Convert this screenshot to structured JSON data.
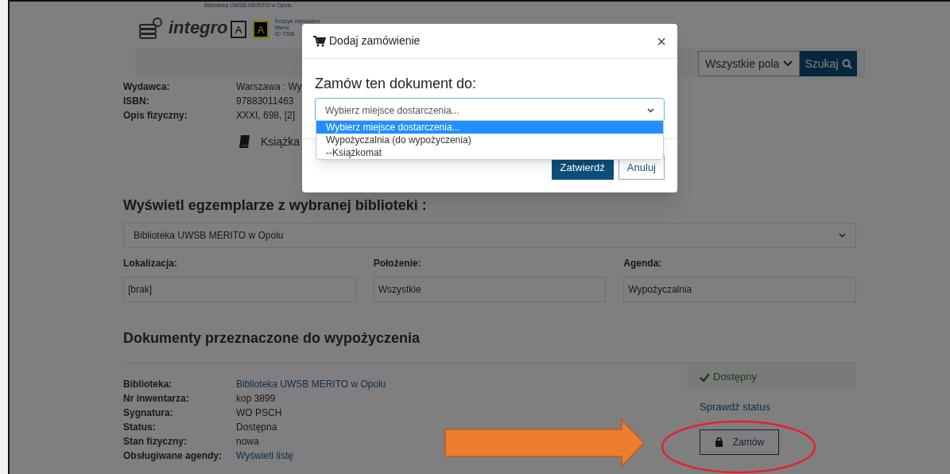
{
  "header": {
    "library_name": "Biblioteka UWSB MERITO w Opolu",
    "logo_text": "integro",
    "contrast_buttons": [
      {
        "label": "A",
        "kind": "normal"
      },
      {
        "label": "A",
        "kind": "high"
      }
    ],
    "links": [
      "Koszyk zamówień",
      "Menu",
      "ID 7266"
    ]
  },
  "search": {
    "field_select": "Wszystkie pola",
    "button": "Szukaj"
  },
  "details": [
    {
      "label": "Wydawca:",
      "value": "Warszawa : Wy"
    },
    {
      "label": "ISBN:",
      "value": "97883011463"
    },
    {
      "label": "Opis fizyczny:",
      "value": "XXXI, 698, [2]"
    }
  ],
  "format": "Książka",
  "copies_section": {
    "title": "Wyświetl egzemplarze z wybranej biblioteki :",
    "library_select": "Biblioteka UWSB MERITO w Opolu",
    "filters": [
      {
        "label": "Lokalizacja:",
        "value": "[brak]"
      },
      {
        "label": "Położenie:",
        "value": "Wszystkie"
      },
      {
        "label": "Agenda:",
        "value": "Wypożyczalnia"
      }
    ]
  },
  "loan_section": {
    "title": "Dokumenty przeznaczone do wypożyczenia",
    "rows": [
      {
        "label": "Biblioteka:",
        "value": "Biblioteka UWSB MERITO w Opolu",
        "kind": "link"
      },
      {
        "label": "Nr inwentarza:",
        "value": "kop 3899",
        "kind": "text"
      },
      {
        "label": "Sygnatura:",
        "value": "WO PSCH",
        "kind": "text"
      },
      {
        "label": "Status:",
        "value": "Dostępna",
        "kind": "text"
      },
      {
        "label": "Stan fizyczny:",
        "value": "nowa",
        "kind": "text"
      },
      {
        "label": "Obsługiwane agendy:",
        "value": "Wyświetl listę",
        "kind": "link"
      }
    ],
    "availability": "Dostępny",
    "check_status": "Sprawdź status",
    "order_button": "Zamów"
  },
  "modal": {
    "title": "Dodaj zamówienie",
    "close": "×",
    "heading": "Zamów ten dokument do:",
    "select_value": "Wybierz miejsce dostarczenia...",
    "options": [
      {
        "label": "Wybierz miejsce dostarczenia...",
        "selected": true
      },
      {
        "label": "Wypożyczalnia (do wypożyczenia)",
        "selected": false
      },
      {
        "label": "--Książkomat",
        "selected": false
      }
    ],
    "buttons": [
      {
        "label": "Zatwierdź",
        "kind": "primary"
      },
      {
        "label": "Anuluj",
        "kind": "secondary"
      }
    ]
  }
}
